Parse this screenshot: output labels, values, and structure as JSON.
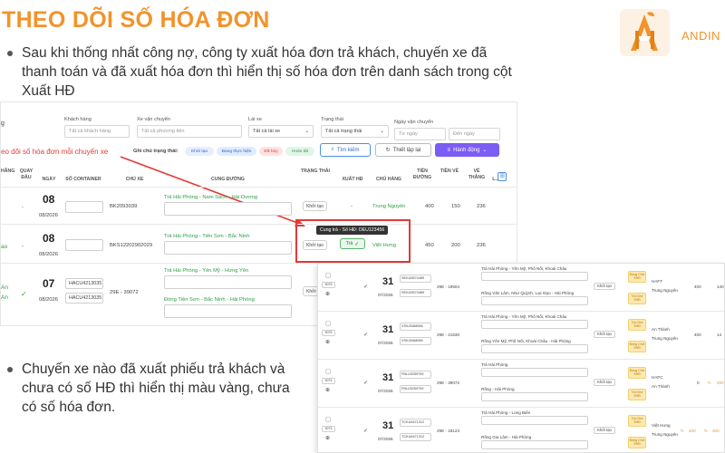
{
  "slide": {
    "title": "THEO DÕI SỐ HÓA ĐƠN",
    "brand": "ANDIN",
    "bullet1": "Sau khi thống nhất công nợ, công ty xuất hóa đơn trả khách,  chuyến xe đã thanh toán và đã xuất hóa đơn thì hiển thị số hóa đơn trên danh sách trong cột Xuất HĐ",
    "bullet2": "Chuyến xe nào đã xuất phiếu trả khách và chưa có số HĐ thì hiển thị màu vàng, chưa có số hóa đơn.",
    "colors": {
      "accent": "#f2932b",
      "highlight": "#e53935",
      "primary_button": "#7b5cf5"
    }
  },
  "filters": {
    "customer_label": "Khách hàng",
    "customer_placeholder": "Tất cả khách hàng",
    "trip_label": "Xe vận chuyển",
    "trip_placeholder": "Tất cả phương tiện",
    "truck_type_label": "Lái xe",
    "truck_type_value": "Tất cả lái xe",
    "status_label": "Trạng thái",
    "status_value": "Tất cả trạng thái",
    "date_label": "Ngày vận chuyển",
    "date_from": "Từ ngày",
    "date_to": "Đến ngày",
    "legend_label": "Ghi chú trạng thái:",
    "legend_chips": [
      "Khởi tạo",
      "Đang thực hiện",
      "Đã hủy",
      "Hoàn tất"
    ],
    "search_button": "Tìm kiếm",
    "reset_button": "Thiết lập lại",
    "action_button": "Hành động"
  },
  "annotation": "eo dõi số hóa đơn mỗi chuyến xe",
  "table1": {
    "headers": [
      "HÃNG",
      "QUAY ĐẦU",
      "NGÀY",
      "SỐ CONTAINER",
      "CHỦ XE",
      "CUNG ĐƯỜNG",
      "TRẠNG THÁI",
      "XUẤT HĐ",
      "CHỦ HÀNG",
      "TIỀN ĐƯỜNG",
      "TIỀN VÉ",
      "VÉ THẮNG",
      "L..."
    ],
    "rows": [
      {
        "dash": "-",
        "day": "08",
        "month": "08/2026",
        "truck": "BK2093039",
        "route": "Trả Hải Phòng - Nam Sách - Hải Dương",
        "status": "Khởi tạo",
        "invoice": "-",
        "owner": "Trung Nguyên",
        "road": "400",
        "ticket": "150",
        "win": "236"
      },
      {
        "dash": "-",
        "day": "08",
        "month": "08/2026",
        "truck": "BKS12202902029",
        "route": "Trả Hải Phòng - Tiên Sơn - Bắc Ninh",
        "status": "Khởi tạo",
        "invoice_tooltip": "Cung trả - Số HĐ: OEU123456",
        "invoice": "Trả",
        "owner": "Việt Hưng",
        "road": "450",
        "ticket": "200",
        "win": "236"
      },
      {
        "day": "07",
        "month": "08/2026",
        "container1": "HACU4213035",
        "container2": "HACU4213035",
        "truck": "29E - 39072",
        "route": "Trả Hải Phòng - Yên Mỹ - Hưng Yên",
        "route2": "Đóng Tiên Sơn - Bắc Ninh - Hải Phòng",
        "status": "Khởi tạo"
      }
    ],
    "left_fragments": [
      "g",
      "ao",
      "An",
      "An"
    ]
  },
  "table2": {
    "rows": [
      {
        "day": "31",
        "month": "07/2026",
        "code": "9075",
        "c1": "SEKU5574489",
        "c2": "SEKU5574489",
        "truck": "29E - 19504",
        "route1": "Trả Hải Phòng - Yên Mỹ, Phố Nối, Khoái Châu",
        "route2": "Rồng Văn Lâm, Như Quỳnh, Lạc Đạo - Hải Phòng",
        "status": "Khởi tạo",
        "y1": "Đóng Chờ SHĐ",
        "y2": "Trả Chờ SHĐ",
        "owner1": "HAFT",
        "owner2": "Trung Nguyên",
        "road": "400",
        "extra": "140"
      },
      {
        "day": "31",
        "month": "07/2026",
        "code": "9075",
        "c1": "VSIU3468086",
        "c2": "VSIU3468086",
        "truck": "29E - 21630",
        "route1": "Trả Hải Phòng - Yên Mỹ, Phố Nối, Khoái Châu",
        "route2": "Rồng Yên Mỹ, Phố Nối, Khoái Châu - Hải Phòng",
        "status": "Khởi tạo",
        "y1": "Trả Chờ SHĐ",
        "y2": "Đóng Chờ SHĐ",
        "owner1": "An Thành",
        "owner2": "Trung Nguyên",
        "road": "400",
        "extra": "14"
      },
      {
        "day": "31",
        "month": "07/2026",
        "code": "9074",
        "c1": "FBLU0259759",
        "c2": "FBLU0259759",
        "truck": "29E - 39072",
        "route1": "Trả Hải Phòng",
        "route2": "Rồng - Hải Phòng",
        "status": "Khởi tạo",
        "y1": "Đóng Chờ SHĐ",
        "y2": "Trả Chờ SHĐ",
        "owner1": "HAFC",
        "owner2": "An Thành",
        "road": "0",
        "extra": "200"
      },
      {
        "day": "31",
        "month": "07/2026",
        "code": "9073",
        "c1": "TCKU6471312",
        "c2": "TCKU6471312",
        "truck": "29E - 18123",
        "route1": "Trả Hải Phòng - Long Biên",
        "route2": "Rồng Gia Lâm - Hải Phòng",
        "status": "Khởi tạo",
        "y1": "Trả Chờ SHĐ",
        "y2": "Đóng Chờ SHĐ",
        "owner1": "Việt Hưng",
        "owner2": "Trung Nguyên",
        "road": "400",
        "extra": "200"
      }
    ]
  }
}
